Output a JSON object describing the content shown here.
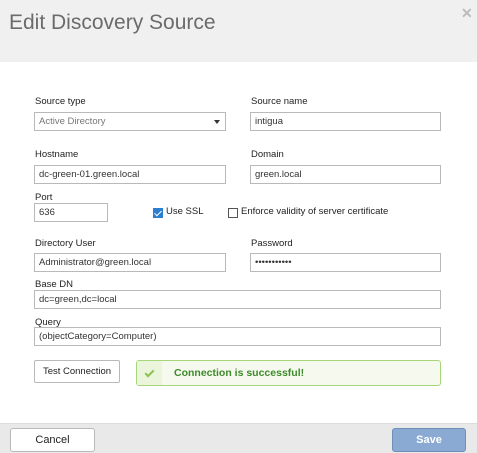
{
  "dialog": {
    "title": "Edit Discovery Source",
    "close_icon": "close-icon"
  },
  "form": {
    "source_type": {
      "label": "Source type",
      "value": "Active Directory"
    },
    "source_name": {
      "label": "Source name",
      "value": "intigua"
    },
    "hostname": {
      "label": "Hostname",
      "value": "dc-green-01.green.local"
    },
    "domain": {
      "label": "Domain",
      "value": "green.local"
    },
    "port": {
      "label": "Port",
      "value": "636"
    },
    "use_ssl": {
      "label": "Use SSL",
      "checked": true
    },
    "enforce_cert": {
      "label": "Enforce validity of server certificate",
      "checked": false
    },
    "directory_user": {
      "label": "Directory User",
      "value": "Administrator@green.local"
    },
    "password": {
      "label": "Password",
      "value": "•••••••••••"
    },
    "base_dn": {
      "label": "Base DN",
      "value": "dc=green,dc=local"
    },
    "query": {
      "label": "Query",
      "value": "(objectCategory=Computer)"
    }
  },
  "actions": {
    "test_connection_label": "Test Connection",
    "status_message": "Connection is successful!",
    "status_icon": "check-icon",
    "cancel_label": "Cancel",
    "save_label": "Save"
  },
  "colors": {
    "success_border": "#a5d67a",
    "success_text": "#3d8a2b",
    "save_button": "#8aaad3",
    "checkbox_checked": "#2c7fd0"
  }
}
